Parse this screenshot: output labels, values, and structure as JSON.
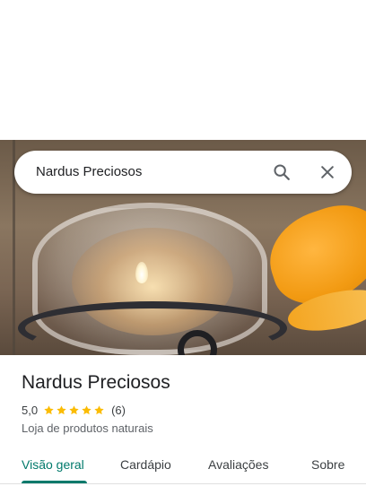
{
  "search": {
    "query": "Nardus Preciosos",
    "search_icon": "search-icon",
    "close_icon": "close-icon"
  },
  "place": {
    "name": "Nardus Preciosos",
    "rating": "5,0",
    "rating_value": 5,
    "review_count": "(6)",
    "category": "Loja de produtos naturais"
  },
  "tabs": [
    {
      "label": "Visão geral",
      "active": true
    },
    {
      "label": "Cardápio",
      "active": false
    },
    {
      "label": "Avaliações",
      "active": false
    },
    {
      "label": "Sobre",
      "active": false
    }
  ],
  "colors": {
    "accent": "#00796b",
    "star": "#fbbc04"
  }
}
